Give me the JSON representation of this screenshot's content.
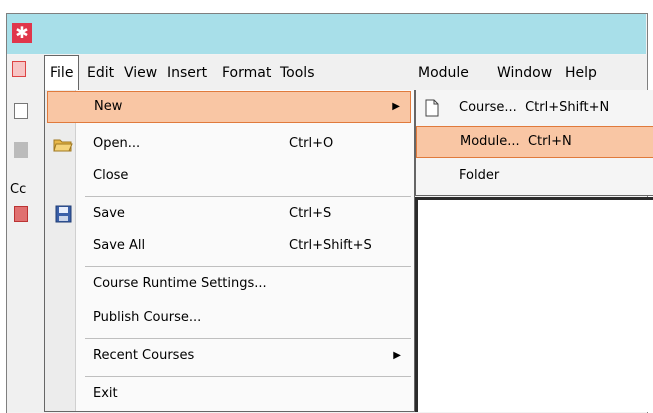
{
  "app": {
    "icon": "app-logo-icon",
    "accent": "#e0364b",
    "titlebar_color": "#a8dfe9"
  },
  "menubar": {
    "items": [
      {
        "label": "File"
      },
      {
        "label": "Edit"
      },
      {
        "label": "View"
      },
      {
        "label": "Insert"
      },
      {
        "label": "Format"
      },
      {
        "label": "Tools"
      },
      {
        "label": "Module"
      },
      {
        "label": "Window"
      },
      {
        "label": "Help"
      }
    ]
  },
  "sidebar_strip": {
    "partial_text": "Cc"
  },
  "file_menu": {
    "items": [
      {
        "label": "New",
        "shortcut": "",
        "submenu": true,
        "highlighted": true
      },
      {
        "label": "Open...",
        "shortcut": "Ctrl+O",
        "icon": "open-folder-icon"
      },
      {
        "label": "Close",
        "shortcut": ""
      },
      {
        "label": "Save",
        "shortcut": "Ctrl+S",
        "icon": "save-disk-icon"
      },
      {
        "label": "Save All",
        "shortcut": "Ctrl+Shift+S"
      },
      {
        "label": "Course Runtime Settings...",
        "shortcut": ""
      },
      {
        "label": "Publish Course...",
        "shortcut": ""
      },
      {
        "label": "Recent Courses",
        "shortcut": "",
        "submenu": true
      },
      {
        "label": "Exit",
        "shortcut": ""
      }
    ],
    "highlight_color": "#f9c6a4"
  },
  "new_submenu": {
    "items": [
      {
        "label": "Course...",
        "shortcut": "Ctrl+Shift+N",
        "icon": "document-icon"
      },
      {
        "label": "Module...",
        "shortcut": "Ctrl+N",
        "highlighted": true
      },
      {
        "label": "Folder",
        "shortcut": ""
      }
    ]
  }
}
